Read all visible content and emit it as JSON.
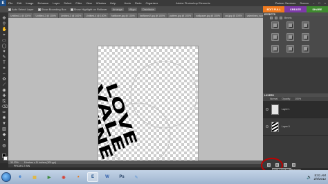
{
  "menubar": {
    "logo_letter": "E",
    "items": [
      "File",
      "Edit",
      "Image",
      "Enhance",
      "Layer",
      "Select",
      "Filter",
      "View",
      "Window",
      "Help"
    ],
    "undo_label": "Undo",
    "redo_label": "Redo",
    "organizer_label": "Organizer",
    "title": "Adobe Photoshop Elements",
    "screen_label": "Screen",
    "partner_label": "Partner Services"
  },
  "options": {
    "items": [
      "Auto Select Layer",
      "Show Bounding Box",
      "Show Highlight on Rollover"
    ],
    "arrange_label": "Arrange",
    "align_label": "Align",
    "distribute_label": "Distribute"
  },
  "modes": [
    {
      "label": "EDIT FULL",
      "color": "#f07a1e"
    },
    {
      "label": "CREATE",
      "color": "#7d3aa8"
    },
    {
      "label": "SHARE",
      "color": "#3f8a2f"
    }
  ],
  "tools": [
    "move-icon",
    "zoom-icon",
    "hand-icon",
    "eyedropper-icon",
    "marquee-icon",
    "lasso-icon",
    "magic-wand-icon",
    "selection-brush-icon",
    "type-icon",
    "crop-icon",
    "recompose-icon",
    "cookie-cutter-icon",
    "straighten-icon",
    "red-eye-icon",
    "healing-icon",
    "clone-icon",
    "eraser-icon",
    "brush-icon",
    "smart-brush-icon",
    "paint-bucket-icon",
    "gradient-icon",
    "shape-icon",
    "blur-icon",
    "sponge-icon"
  ],
  "tool_glyphs": [
    "✥",
    "⚲",
    "✋",
    "⌖",
    "▭",
    "◯",
    "✦",
    "✎",
    "T",
    "⌗",
    "⇔",
    "✿",
    "⟋",
    "◉",
    "✚",
    "⎘",
    "⌫",
    "✏",
    "✺",
    "▼",
    "▥",
    "◆",
    "◔",
    "◍"
  ],
  "tabs": [
    {
      "label": "Untitled-1 @ 100%"
    },
    {
      "label": "Untitled-2 @ 100%"
    },
    {
      "label": "Untitled-3 @ 100%"
    },
    {
      "label": "Untitled-4 @ 100%"
    },
    {
      "label": "hatflower.jpg @ 100%"
    },
    {
      "label": "hatflower2.jpg @ 100%"
    },
    {
      "label": "pattern.jpg @ 100%"
    },
    {
      "label": "wallpaper.jpg @ 100%"
    },
    {
      "label": "cat.jpg @ 100%"
    },
    {
      "label": "valentines_wordle.jpg @ 100%"
    },
    {
      "label": "valentines_wordlebackground_font_at.jpg @ 100%"
    },
    {
      "label": "words.jpg @ 100%"
    }
  ],
  "active_tab_index": 10,
  "canvas": {
    "art_line1": "LOVE",
    "art_line2": "VALE",
    "art_line3": "NTINE"
  },
  "status": {
    "zoom": "33.33%",
    "doc_info": "8 inches x 11 inches (300 ppi)"
  },
  "bin": {
    "label": "PROJECT BIN"
  },
  "effects": {
    "header": "EFFECTS",
    "options": [
      "Bevels"
    ],
    "thumbs": [
      "effect-1",
      "effect-2",
      "effect-3",
      "effect-4",
      "effect-5",
      "effect-6",
      "effect-7",
      "effect-8",
      "effect-9"
    ]
  },
  "layers": {
    "header": "LAYERS",
    "blend_mode": "Normal",
    "opacity_label": "Opacity:",
    "opacity_value": "100%",
    "items": [
      {
        "name": "Layer 1",
        "selected": true
      },
      {
        "name": "Layer 0",
        "selected": false
      }
    ]
  },
  "tooltip": "Create a new fill or adjustment layer",
  "taskbar": {
    "apps": [
      "IE",
      "Explorer",
      "Media",
      "Chrome",
      "Firefox",
      "Elements",
      "Word",
      "Photoshop",
      "Paint"
    ],
    "app_letters": [
      "e",
      "▦",
      "▶",
      "◉",
      "◕",
      "E",
      "W",
      "Ps",
      "✎"
    ],
    "app_colors": [
      "#1f6fd0",
      "#e4b73b",
      "#3d8a3d",
      "#d64437",
      "#e5781b",
      "#1b4c86",
      "#2b5aa8",
      "#1e3a5f",
      "#7fa8d8"
    ],
    "time": "8:01 AM",
    "date": "2/9/2012"
  },
  "colors": {
    "annotation": "#c00000",
    "workspace": "#bdbdbd",
    "panel": "#3a3a3a"
  }
}
